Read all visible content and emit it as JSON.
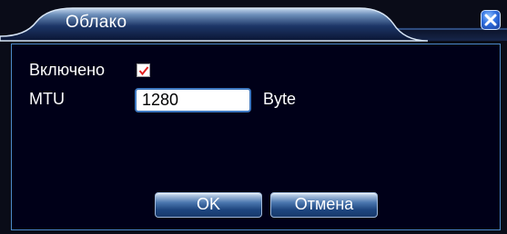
{
  "dialog": {
    "title": "Облако",
    "close_icon": "close-icon"
  },
  "form": {
    "enabled_label": "Включено",
    "enabled_checked": true,
    "mtu_label": "MTU",
    "mtu_value": "1280",
    "mtu_unit": "Byte"
  },
  "buttons": {
    "ok_label": "OK",
    "cancel_label": "Отмена"
  },
  "colors": {
    "background": "#000018",
    "title_bar": "#0e1a3a",
    "border": "#4d8ac8",
    "text": "#ffffff",
    "checkmark": "#e02020"
  }
}
